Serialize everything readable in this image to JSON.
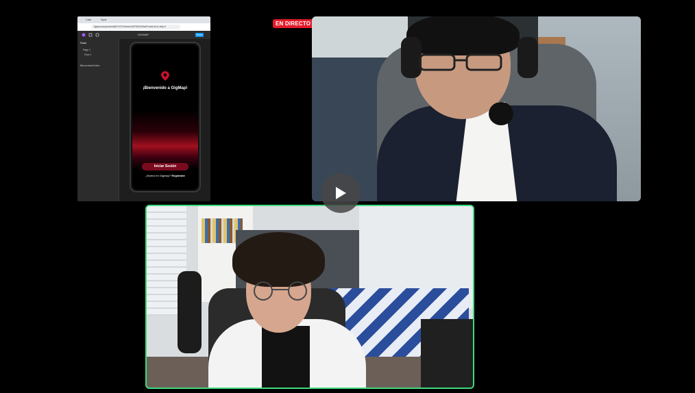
{
  "live_badge": {
    "label": "EN DIRECTO",
    "color": "#e21b2a"
  },
  "screen_share": {
    "browser_tabs": [
      "Cale",
      "Spot",
      "",
      "",
      "",
      "",
      ""
    ],
    "url": "figma.com/proto/k4BJ7h7h7s/mmkJUFSlIZ4ZHalf?node-id=4-4&p=f",
    "file_name": "GIGMAP",
    "share_button": "Share",
    "left_panel": {
      "header": "Flows",
      "items": [
        "Page 1",
        "Flow 1"
      ],
      "footer": "Bienvenido/Detect"
    },
    "app_screen": {
      "title": "¡Bienvenido a GigMap!",
      "login_button": "Iniciar Sesión",
      "signup_prompt": "¿Nuevo en Gigmap?",
      "signup_link": "Registrate",
      "accent_color": "#7a0b1f"
    }
  },
  "participants": [
    {
      "name": "",
      "speaking": false
    },
    {
      "name": "",
      "speaking": true,
      "speaking_color": "#3ddc7e"
    }
  ],
  "controls": {
    "play_icon": "play-icon"
  }
}
